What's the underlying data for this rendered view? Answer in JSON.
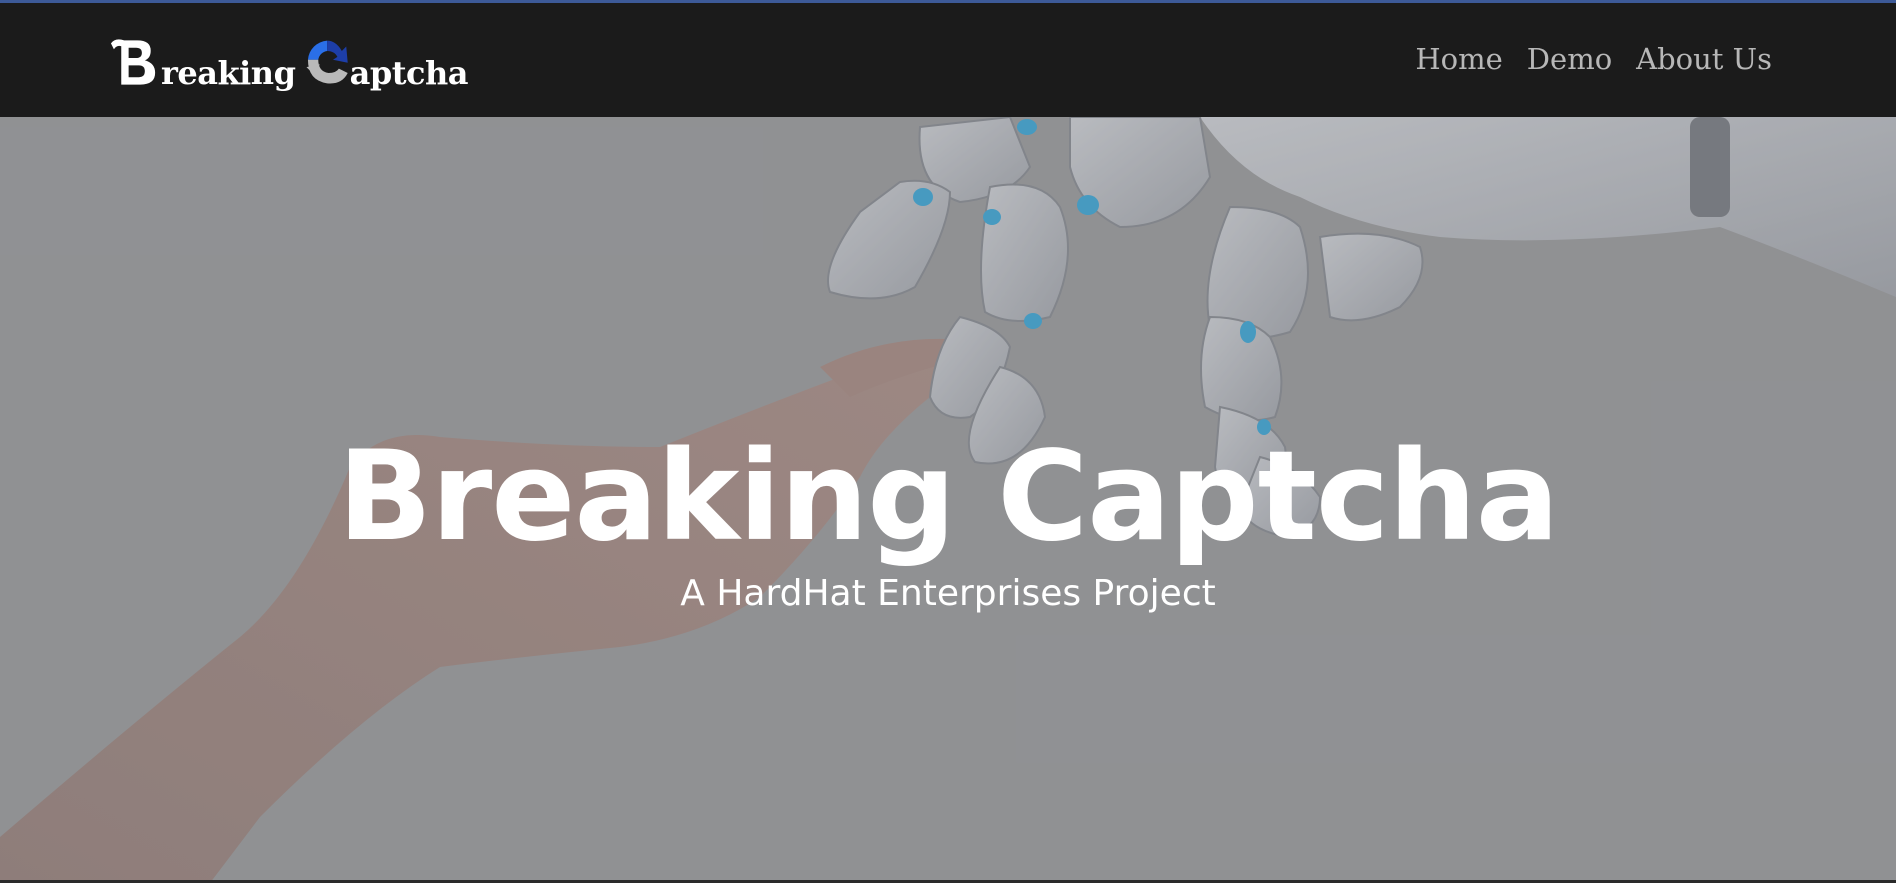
{
  "brand": {
    "first_word": "reaking",
    "second_word": "aptcha",
    "logo_b_icon": "breaking-b-logo-icon",
    "logo_c_icon": "refresh-captcha-c-logo-icon",
    "colors": {
      "logo_blue": "#2a6fe8",
      "logo_dark_blue": "#1d3ea8",
      "logo_gray": "#b9b9b9"
    }
  },
  "nav": {
    "items": [
      {
        "label": "Home"
      },
      {
        "label": "Demo"
      },
      {
        "label": "About Us"
      }
    ]
  },
  "hero": {
    "title": "Breaking Captcha",
    "subtitle": "A HardHat Enterprises Project",
    "background_image": "human-hand-reaching-robot-hand",
    "overlay_color": "#919294"
  },
  "colors": {
    "navbar": "#1b1b1b",
    "nav_link": "#b7b7b7",
    "hero_text": "#ffffff"
  }
}
